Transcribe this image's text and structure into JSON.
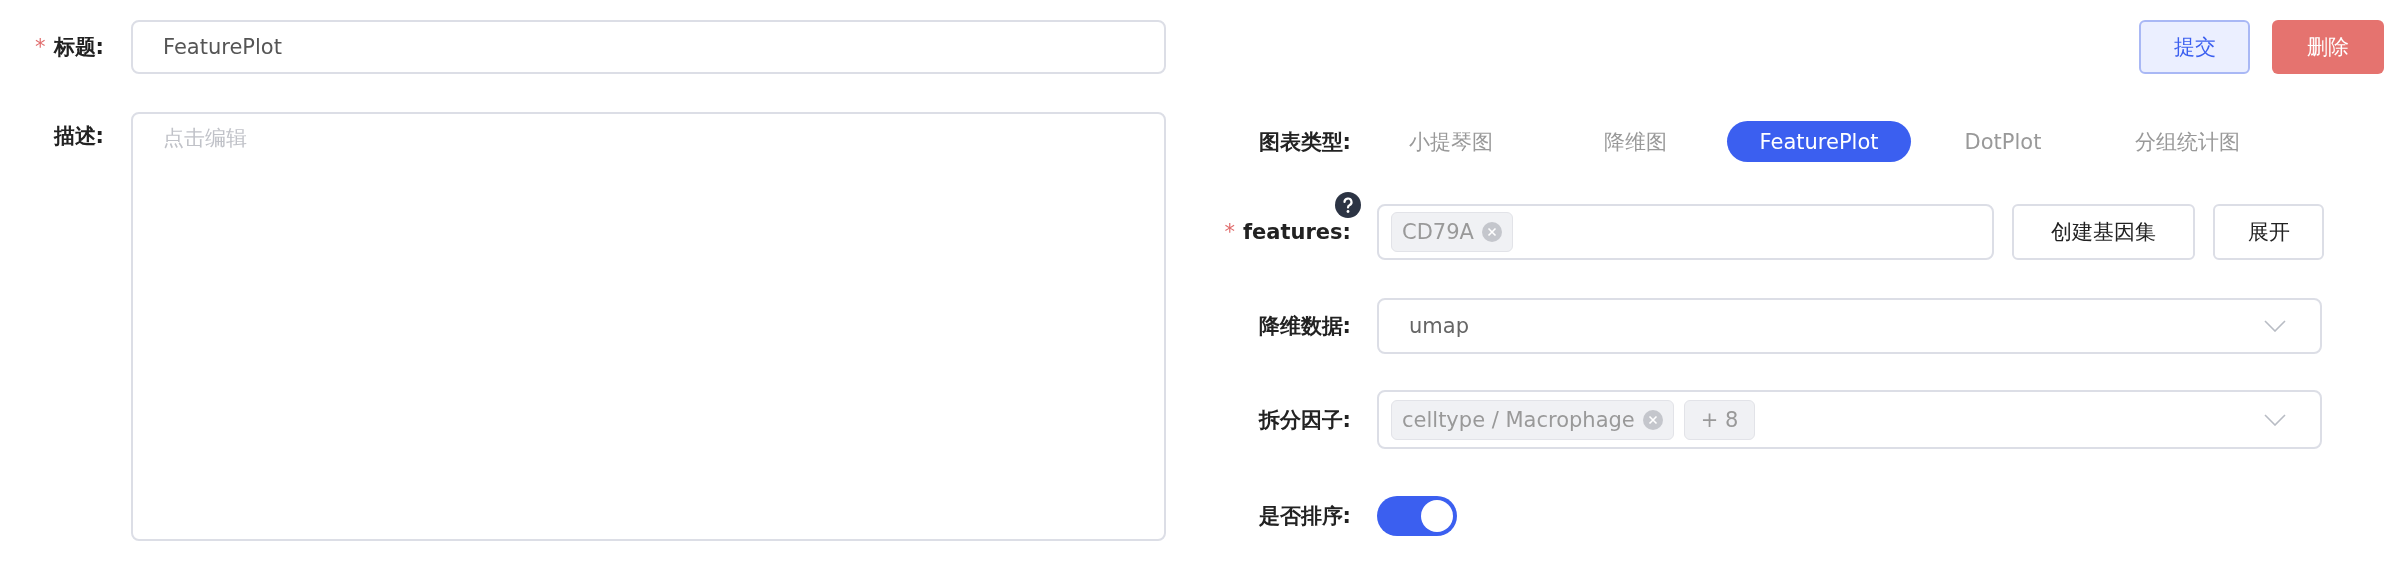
{
  "title_field": {
    "required_mark": "*",
    "label": "标题:",
    "value": "FeaturePlot"
  },
  "description_field": {
    "label": "描述:",
    "placeholder": "点击编辑"
  },
  "buttons": [
    {
      "label": "提交",
      "kind": "primary"
    },
    {
      "label": "删除",
      "kind": "danger"
    }
  ],
  "chart_type": {
    "label": "图表类型:",
    "tabs": [
      {
        "label": "小提琴图",
        "selected": false
      },
      {
        "label": "降维图",
        "selected": false
      },
      {
        "label": "FeaturePlot",
        "selected": true
      },
      {
        "label": "DotPlot",
        "selected": false
      },
      {
        "label": "分组统计图",
        "selected": false
      }
    ]
  },
  "features": {
    "required_mark": "*",
    "label": "features:",
    "tags": [
      "CD79A"
    ],
    "buttons": [
      "创建基因集",
      "展开"
    ]
  },
  "reduction": {
    "label": "降维数据:",
    "value": "umap"
  },
  "split_by": {
    "label": "拆分因子:",
    "tags": [
      "celltype / Macrophage"
    ],
    "more": "+ 8"
  },
  "sort": {
    "label": "是否排序:",
    "on": true
  }
}
